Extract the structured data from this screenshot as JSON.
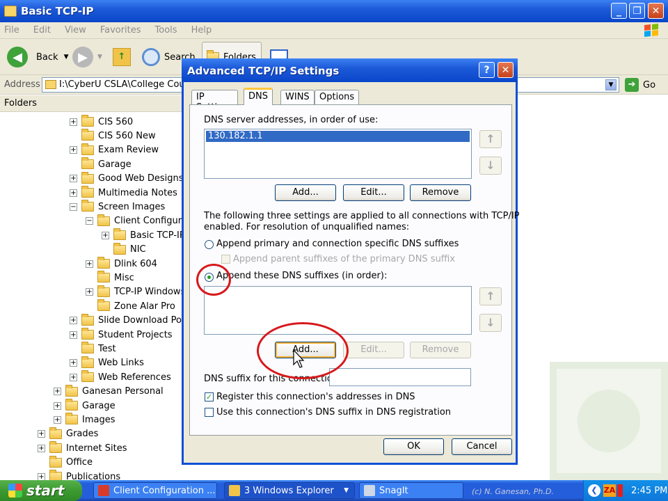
{
  "window": {
    "title": "Basic TCP-IP"
  },
  "menu": [
    "File",
    "Edit",
    "View",
    "Favorites",
    "Tools",
    "Help"
  ],
  "toolbar": {
    "back": "Back",
    "search": "Search",
    "folders": "Folders"
  },
  "address": {
    "label": "Address",
    "value": "I:\\CyberU CSLA\\College Cours",
    "go": "Go"
  },
  "folders_pane": {
    "title": "Folders"
  },
  "tree": [
    {
      "label": "CIS 560",
      "exp": "+",
      "level": 2
    },
    {
      "label": "CIS 560 New",
      "exp": "",
      "level": 2
    },
    {
      "label": "Exam Review",
      "exp": "+",
      "level": 2
    },
    {
      "label": "Garage",
      "exp": "",
      "level": 2
    },
    {
      "label": "Good Web Designs",
      "exp": "+",
      "level": 2
    },
    {
      "label": "Multimedia Notes",
      "exp": "+",
      "level": 2
    },
    {
      "label": "Screen Images",
      "exp": "−",
      "level": 2
    },
    {
      "label": "Client Configurat",
      "exp": "−",
      "level": 3
    },
    {
      "label": "Basic TCP-IP",
      "exp": "+",
      "level": 4
    },
    {
      "label": "NIC",
      "exp": "",
      "level": 4
    },
    {
      "label": "Dlink 604",
      "exp": "+",
      "level": 3
    },
    {
      "label": "Misc",
      "exp": "",
      "level": 3
    },
    {
      "label": "TCP-IP Windows",
      "exp": "+",
      "level": 3
    },
    {
      "label": "Zone Alar Pro",
      "exp": "",
      "level": 3
    },
    {
      "label": "Slide Download Pool",
      "exp": "+",
      "level": 2
    },
    {
      "label": "Student Projects",
      "exp": "+",
      "level": 2
    },
    {
      "label": "Test",
      "exp": "",
      "level": 2
    },
    {
      "label": "Web Links",
      "exp": "+",
      "level": 2
    },
    {
      "label": "Web References",
      "exp": "+",
      "level": 2
    },
    {
      "label": "Ganesan Personal",
      "exp": "+",
      "level": 1
    },
    {
      "label": "Garage",
      "exp": "+",
      "level": 1
    },
    {
      "label": "Images",
      "exp": "+",
      "level": 1
    },
    {
      "label": "Grades",
      "exp": "+",
      "level": 0
    },
    {
      "label": "Internet Sites",
      "exp": "+",
      "level": 0
    },
    {
      "label": "Office",
      "exp": "",
      "level": 0
    },
    {
      "label": "Publications",
      "exp": "+",
      "level": 0
    }
  ],
  "dialog": {
    "title": "Advanced TCP/IP Settings",
    "help": "?",
    "close": "✕",
    "tabs": [
      "IP Settings",
      "DNS",
      "WINS",
      "Options"
    ],
    "dns_servers_label": "DNS server addresses, in order of use:",
    "dns_servers": [
      "130.182.1.1"
    ],
    "add": "Add...",
    "edit": "Edit...",
    "remove": "Remove",
    "info_line1": "The following three settings are applied to all connections with TCP/IP",
    "info_line2": "enabled. For resolution of unqualified names:",
    "radio_primary": "Append primary and connection specific DNS suffixes",
    "check_parent": "Append parent suffixes of the primary DNS suffix",
    "radio_these": "Append these DNS suffixes (in order):",
    "suffix_label": "DNS suffix for this connection:",
    "check_register": "Register this connection's addresses in DNS",
    "check_use_suffix": "Use this connection's DNS suffix in DNS registration",
    "ok": "OK",
    "cancel": "Cancel"
  },
  "taskbar": {
    "start": "start",
    "tasks": [
      "Client Configuration ...",
      "3 Windows Explorer",
      "SnagIt"
    ],
    "clock": "2:45 PM",
    "copyright": "(c) N. Ganesan, Ph.D."
  }
}
